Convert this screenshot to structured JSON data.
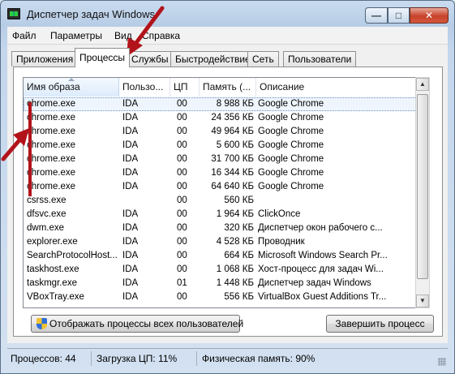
{
  "window": {
    "title": "Диспетчер задач Windows",
    "controls": {
      "minimize": "—",
      "maximize": "□",
      "close": "✕"
    }
  },
  "menu": [
    "Файл",
    "Параметры",
    "Вид",
    "Справка"
  ],
  "tabs": [
    "Приложения",
    "Процессы",
    "Службы",
    "Быстродействие",
    "Сеть",
    "Пользователи"
  ],
  "active_tab": "Процессы",
  "columns": [
    "Имя образа",
    "Пользо...",
    "ЦП",
    "Память (...",
    "Описание"
  ],
  "processes": [
    {
      "name": "chrome.exe",
      "user": "IDA",
      "cpu": "00",
      "mem": "8 988 КБ",
      "desc": "Google Chrome",
      "selected": true
    },
    {
      "name": "chrome.exe",
      "user": "IDA",
      "cpu": "00",
      "mem": "24 356 КБ",
      "desc": "Google Chrome"
    },
    {
      "name": "chrome.exe",
      "user": "IDA",
      "cpu": "00",
      "mem": "49 964 КБ",
      "desc": "Google Chrome"
    },
    {
      "name": "chrome.exe",
      "user": "IDA",
      "cpu": "00",
      "mem": "5 600 КБ",
      "desc": "Google Chrome"
    },
    {
      "name": "chrome.exe",
      "user": "IDA",
      "cpu": "00",
      "mem": "31 700 КБ",
      "desc": "Google Chrome"
    },
    {
      "name": "chrome.exe",
      "user": "IDA",
      "cpu": "00",
      "mem": "16 344 КБ",
      "desc": "Google Chrome"
    },
    {
      "name": "chrome.exe",
      "user": "IDA",
      "cpu": "00",
      "mem": "64 640 КБ",
      "desc": "Google Chrome"
    },
    {
      "name": "csrss.exe",
      "user": "",
      "cpu": "00",
      "mem": "560 КБ",
      "desc": ""
    },
    {
      "name": "dfsvc.exe",
      "user": "IDA",
      "cpu": "00",
      "mem": "1 964 КБ",
      "desc": "ClickOnce"
    },
    {
      "name": "dwm.exe",
      "user": "IDA",
      "cpu": "00",
      "mem": "320 КБ",
      "desc": "Диспетчер окон рабочего с..."
    },
    {
      "name": "explorer.exe",
      "user": "IDA",
      "cpu": "00",
      "mem": "4 528 КБ",
      "desc": "Проводник"
    },
    {
      "name": "SearchProtocolHost...",
      "user": "IDA",
      "cpu": "00",
      "mem": "664 КБ",
      "desc": "Microsoft Windows Search Pr..."
    },
    {
      "name": "taskhost.exe",
      "user": "IDA",
      "cpu": "00",
      "mem": "1 068 КБ",
      "desc": "Хост-процесс для задач Wi..."
    },
    {
      "name": "taskmgr.exe",
      "user": "IDA",
      "cpu": "01",
      "mem": "1 448 КБ",
      "desc": "Диспетчер задач Windows"
    },
    {
      "name": "VBoxTray.exe",
      "user": "IDA",
      "cpu": "00",
      "mem": "556 КБ",
      "desc": "VirtualBox Guest Additions Tr..."
    }
  ],
  "buttons": {
    "show_all": "Отображать процессы всех пользователей",
    "end_process": "Завершить процесс"
  },
  "status": {
    "processes": "Процессов: 44",
    "cpu": "Загрузка ЦП: 11%",
    "memory": "Физическая память: 90%"
  },
  "colors": {
    "annotation_arrow": "#b2131b",
    "selection": "#eef5fd"
  }
}
